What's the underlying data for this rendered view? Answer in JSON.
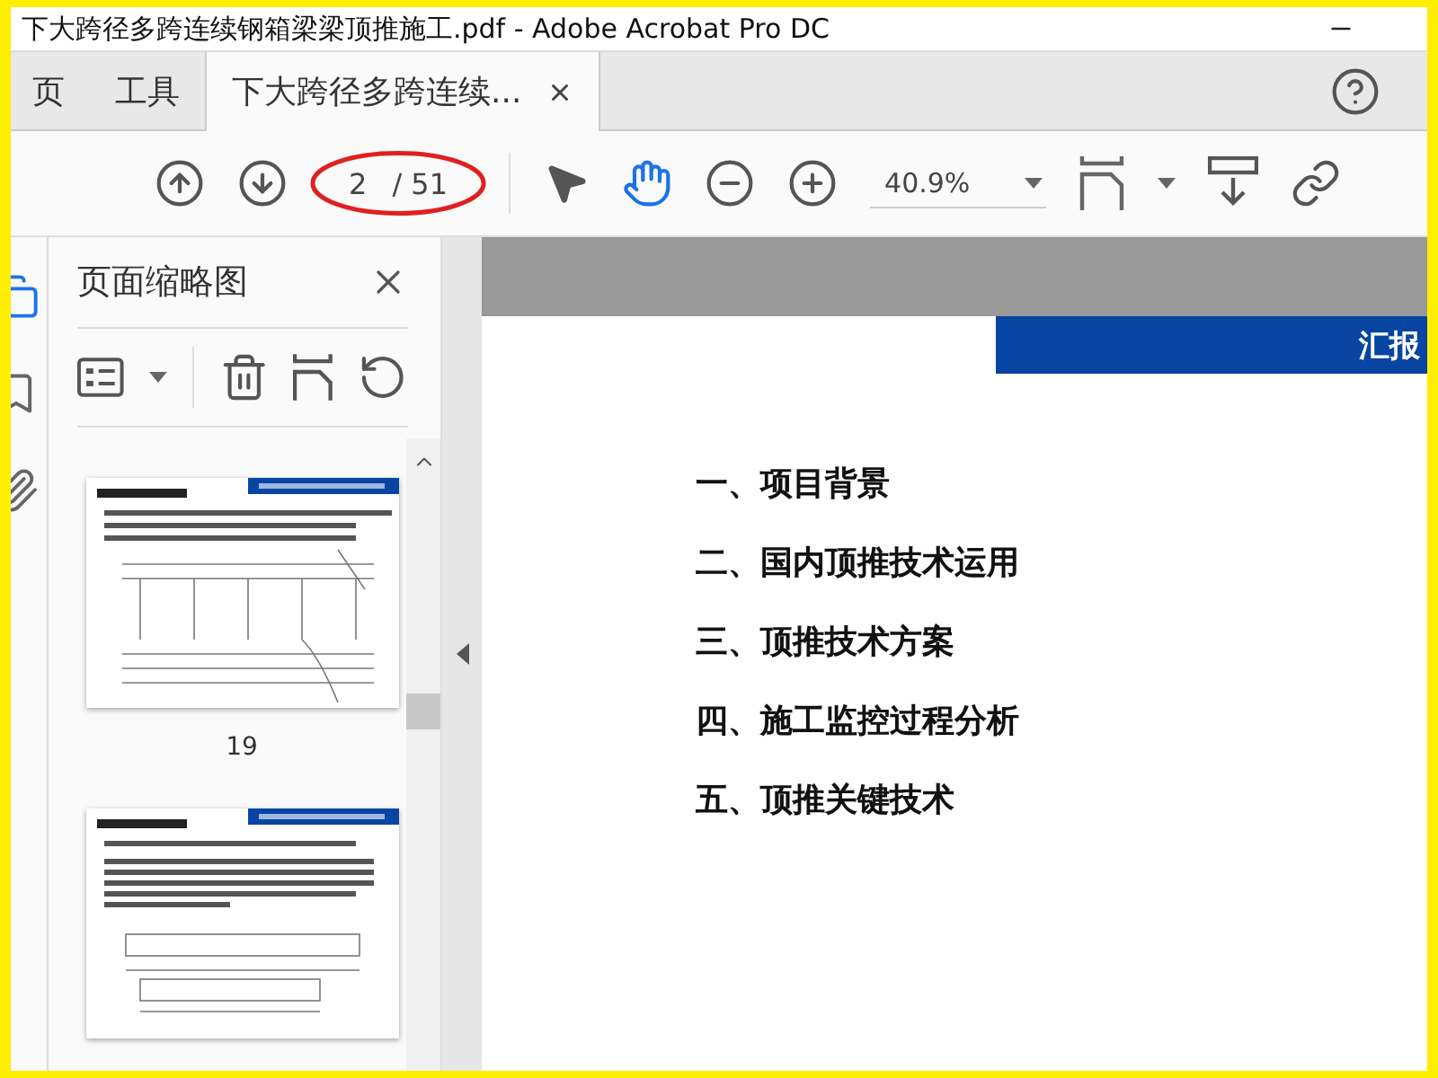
{
  "window": {
    "title": "下大跨径多跨连续钢箱梁梁顶推施工.pdf - Adobe Acrobat Pro DC"
  },
  "tabs": [
    {
      "label": "页",
      "selected": false
    },
    {
      "label": "工具",
      "selected": false
    },
    {
      "label": "下大跨径多跨连续...",
      "selected": true,
      "closable": true
    }
  ],
  "toolbar": {
    "page_number": "2",
    "page_total": "/ 51",
    "zoom": "40.9%"
  },
  "thumbnail_panel": {
    "title": "页面缩略图",
    "thumbnails": [
      {
        "kind": "page",
        "label": "19"
      },
      {
        "kind": "page"
      }
    ]
  },
  "document": {
    "header": "汇报",
    "items": [
      "一、项目背景",
      "二、国内顶推技术运用",
      "三、顶推技术方案",
      "四、施工监控过程分析",
      "五、顶推关键技术"
    ]
  }
}
